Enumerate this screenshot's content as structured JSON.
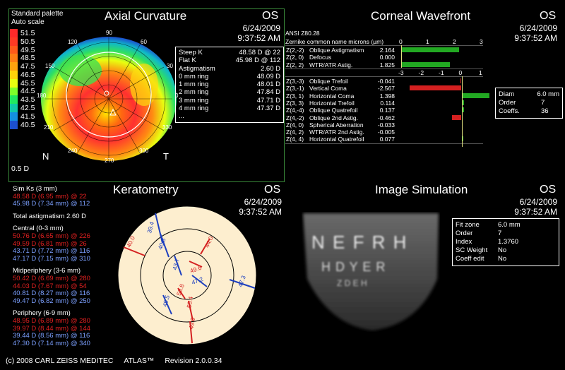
{
  "axial": {
    "palette": "Standard palette",
    "scale": "Auto scale",
    "title": "Axial Curvature",
    "eye": "OS",
    "date": "6/24/2009",
    "time": "9:37:52 AM",
    "legend": [
      {
        "label": "51.5",
        "color": "#ff2a2a"
      },
      {
        "label": "50.5",
        "color": "#ff3a24"
      },
      {
        "label": "49.5",
        "color": "#ff5a1a"
      },
      {
        "label": "48.5",
        "color": "#ff7d14"
      },
      {
        "label": "47.5",
        "color": "#ffa20e"
      },
      {
        "label": "46.5",
        "color": "#ffd20a"
      },
      {
        "label": "45.5",
        "color": "#e8ff10"
      },
      {
        "label": "44.5",
        "color": "#7dff2a"
      },
      {
        "label": "43.5",
        "color": "#20e860"
      },
      {
        "label": "42.5",
        "color": "#10c8a8"
      },
      {
        "label": "41.5",
        "color": "#1490e0"
      },
      {
        "label": "40.5",
        "color": "#1c50d0"
      }
    ],
    "legend_step": "0.5 D",
    "nasal_label": "N",
    "temporal_label": "T",
    "axis_labels": [
      "90",
      "120",
      "60",
      "150",
      "30",
      "180",
      "0",
      "210",
      "330",
      "240",
      "300",
      "270"
    ],
    "kvals": [
      {
        "k": "Steep K",
        "v": "48.58 D @ 22"
      },
      {
        "k": "Flat K",
        "v": "45.98 D @ 112"
      },
      {
        "k": "Astigmatism",
        "v": "2.60 D"
      },
      {
        "k": "0 mm ring",
        "v": "48.09 D"
      },
      {
        "k": "1 mm ring",
        "v": "48.01 D"
      },
      {
        "k": "2 mm ring",
        "v": "47.84 D"
      },
      {
        "k": "3 mm ring",
        "v": "47.71 D"
      },
      {
        "k": "4 mm ring",
        "v": "47.37 D"
      },
      {
        "k": "...",
        "v": ""
      }
    ]
  },
  "wavefront": {
    "title": "Corneal Wavefront",
    "eye": "OS",
    "date": "6/24/2009",
    "time": "9:37:52 AM",
    "standard": "ANSI Z80.28",
    "header": "Zernike common name microns (µm)",
    "scale_top": [
      "0",
      "1",
      "2",
      "3"
    ],
    "scale_mid": [
      "-3",
      "-2",
      "-1",
      "0",
      "1"
    ],
    "group1": [
      {
        "z": "Z(2,-2)",
        "name": "Oblique Astigmatism",
        "val": "2.164",
        "num": 2.164
      },
      {
        "z": "Z(2, 0)",
        "name": "Defocus",
        "val": "0.000",
        "num": 0.0
      },
      {
        "z": "Z(2, 2)",
        "name": "WTR/ATR Astig.",
        "val": "1.825",
        "num": 1.825
      }
    ],
    "group2": [
      {
        "z": "Z(3,-3)",
        "name": "Oblique Trefoil",
        "val": "-0.041",
        "num": -0.041
      },
      {
        "z": "Z(3,-1)",
        "name": "Vertical Coma",
        "val": "-2.567",
        "num": -2.567
      },
      {
        "z": "Z(3, 1)",
        "name": "Horizontal Coma",
        "val": "1.398",
        "num": 1.398
      },
      {
        "z": "Z(3, 3)",
        "name": "Horizontal Trefoil",
        "val": "0.114",
        "num": 0.114
      },
      {
        "z": "Z(4,-4)",
        "name": "Oblique Quatrefoil",
        "val": "0.137",
        "num": 0.137
      },
      {
        "z": "Z(4,-2)",
        "name": "Oblique 2nd Astig.",
        "val": "-0.462",
        "num": -0.462
      },
      {
        "z": "Z(4, 0)",
        "name": "Spherical Aberration",
        "val": "-0.033",
        "num": -0.033
      },
      {
        "z": "Z(4, 2)",
        "name": "WTR/ATR 2nd Astig.",
        "val": "-0.005",
        "num": -0.005
      },
      {
        "z": "Z(4, 4)",
        "name": "Horizontal Quatrefoil",
        "val": "0.077",
        "num": 0.077
      }
    ],
    "info": [
      {
        "k": "Diam",
        "v": "6.0 mm"
      },
      {
        "k": "Order",
        "v": "7"
      },
      {
        "k": "Coeffs.",
        "v": "36"
      }
    ]
  },
  "kerato": {
    "title": "Keratometry",
    "eye": "OS",
    "date": "6/24/2009",
    "time": "9:37:52 AM",
    "sim_ks_label": "Sim Ks (3 mm)",
    "sim_ks": [
      {
        "text": "48.58 D (6.95 mm) @ 22",
        "color": "red"
      },
      {
        "text": "45.98 D (7.34 mm) @ 112",
        "color": "blue"
      }
    ],
    "total_astig": "Total astigmatism 2.60 D",
    "central_label": "Central (0-3 mm)",
    "central": [
      {
        "text": "50.76 D (6.65 mm) @ 226",
        "color": "red"
      },
      {
        "text": "49.59 D (6.81 mm) @ 26",
        "color": "red"
      },
      {
        "text": "43.71 D (7.72 mm) @ 116",
        "color": "blue"
      },
      {
        "text": "47.17 D (7.15 mm) @ 310",
        "color": "blue"
      }
    ],
    "mid_label": "Midperiphery (3-6 mm)",
    "mid": [
      {
        "text": "50.42 D (6.69 mm) @ 280",
        "color": "red"
      },
      {
        "text": "44.03 D (7.67 mm) @ 54",
        "color": "red"
      },
      {
        "text": "40.81 D (8.27 mm) @ 116",
        "color": "blue"
      },
      {
        "text": "49.47 D (6.82 mm) @ 250",
        "color": "blue"
      }
    ],
    "peri_label": "Periphery (6-9 mm)",
    "peri": [
      {
        "text": "48.95 D (6.89 mm) @ 280",
        "color": "red"
      },
      {
        "text": "39.97 D (8.44 mm) @ 144",
        "color": "red"
      },
      {
        "text": "39.44 D (8.56 mm) @ 116",
        "color": "blue"
      },
      {
        "text": "47.30 D (7.14 mm) @ 340",
        "color": "blue"
      }
    ],
    "diagram_labels": {
      "l394": "39.4",
      "l400": "40.0",
      "l408": "40.8",
      "l440": "44.0",
      "l437": "43.7",
      "l496": "49.6",
      "l472": "47.2",
      "l508": "50.8",
      "l473": "47.3",
      "l495": "49.5",
      "l504": "50.4",
      "l490": "49.0"
    }
  },
  "simulation": {
    "title": "Image Simulation",
    "eye": "OS",
    "date": "6/24/2009",
    "time": "9:37:52 AM",
    "chart_line1": "N E F R H",
    "chart_line2": "H D Y E R",
    "chart_line3": "Z D E H",
    "info": [
      {
        "k": "Fit zone",
        "v": "6.0 mm"
      },
      {
        "k": "Order",
        "v": "7"
      },
      {
        "k": "Index",
        "v": "1.3760"
      },
      {
        "k": "SC Weight",
        "v": "No"
      },
      {
        "k": "Coeff edit",
        "v": "No"
      }
    ]
  },
  "footer": {
    "copyright": "(c) 2008 CARL ZEISS MEDITEC",
    "product": "ATLAS™",
    "revision": "Revision  2.0.0.34"
  }
}
